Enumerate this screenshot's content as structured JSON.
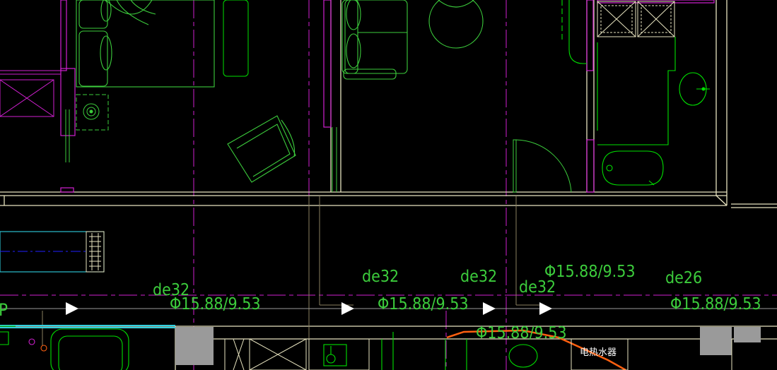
{
  "canvas": {
    "background": "#000000"
  },
  "colors": {
    "wall": "#e8e4c0",
    "magenta": "#d020d0",
    "green": "#00e000",
    "pale_green": "#3ccc3c",
    "blue": "#2020ff",
    "cyan": "#30d0e0",
    "orange": "#ff6010",
    "gray": "#9a9a9a"
  },
  "annotations": {
    "p": "P",
    "de32_a": "de32",
    "phi_a": "Φ15.88/9.53",
    "de32_b": "de32",
    "phi_b": "Φ15.88/9.53",
    "de32_c": "de32",
    "de32_d": "de32",
    "phi_c": "Φ15.88/9.53",
    "phi_d": "Φ15.88/9.53",
    "de26": "de26",
    "phi_e": "Φ15.88/9.53",
    "water_heater": "电热水器"
  },
  "icons": {
    "flow_arrow": "flow-arrow-icon",
    "floor_drain": "floor-drain-icon",
    "wash_basin": "wash-basin-icon",
    "bathtub": "bathtub-icon",
    "armchair": "armchair-icon",
    "round_table": "round-table-icon"
  }
}
